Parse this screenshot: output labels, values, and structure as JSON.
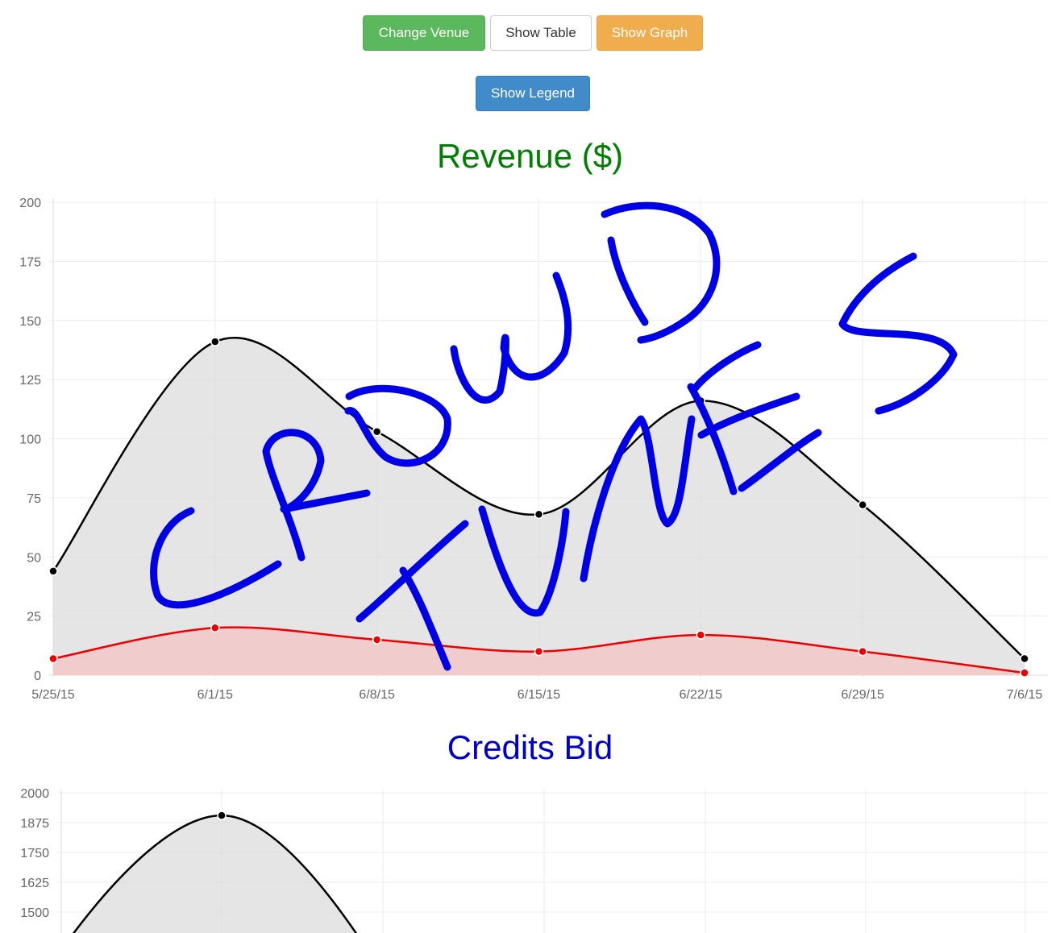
{
  "buttons": {
    "change_venue": "Change Venue",
    "show_table": "Show Table",
    "show_graph": "Show Graph",
    "show_legend": "Show Legend"
  },
  "watermark_text": "CROWD TUNES",
  "colors": {
    "revenue_title": "#008000",
    "credits_title": "#0000cc",
    "watermark": "#0000e6",
    "series_total": "#000000",
    "series_total_fill": "#dcdcdc",
    "series_second": "#ee0000",
    "series_second_fill": "#f2c8c8"
  },
  "chart_data": [
    {
      "type": "area",
      "title": "Revenue ($)",
      "xlabel": "",
      "ylabel": "",
      "categories": [
        "5/25/15",
        "6/1/15",
        "6/8/15",
        "6/15/15",
        "6/22/15",
        "6/29/15",
        "7/6/15"
      ],
      "y_ticks": [
        0,
        25,
        50,
        75,
        100,
        125,
        150,
        175,
        200
      ],
      "ylim": [
        0,
        200
      ],
      "grid": true,
      "series": [
        {
          "values": [
            44,
            141,
            103,
            68,
            116,
            72,
            7
          ],
          "color": "#000000"
        },
        {
          "values": [
            7,
            20,
            15,
            10,
            17,
            10,
            1
          ],
          "color": "#ee0000"
        }
      ]
    },
    {
      "type": "area",
      "title": "Credits Bid",
      "xlabel": "",
      "ylabel": "",
      "y_ticks": [
        1500,
        1625,
        1750,
        1875,
        2000
      ],
      "grid": true,
      "series": [
        {
          "visible_values": [
            1905
          ],
          "color": "#000000"
        }
      ]
    }
  ]
}
